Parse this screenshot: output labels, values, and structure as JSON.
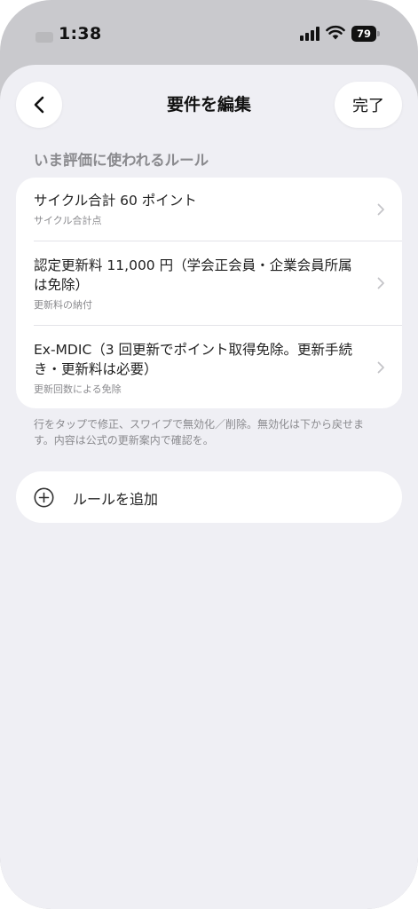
{
  "status_bar": {
    "time": "1:38",
    "battery_level": "79",
    "icons": [
      "signal-icon",
      "wifi-icon",
      "battery-icon"
    ]
  },
  "nav": {
    "back_icon": "chevron-left-icon",
    "title": "要件を編集",
    "done_label": "完了"
  },
  "section": {
    "header": "いま評価に使われるルール"
  },
  "rules": [
    {
      "title": "サイクル合計 60 ポイント",
      "subtitle": "サイクル合計点"
    },
    {
      "title": "認定更新料 11,000 円（学会正会員・企業会員所属は免除）",
      "subtitle": "更新料の納付"
    },
    {
      "title": "Ex-MDIC（3 回更新でポイント取得免除。更新手続き・更新料は必要）",
      "subtitle": "更新回数による免除"
    }
  ],
  "footnote": "行をタップで修正、スワイプで無効化／削除。無効化は下から戻せます。内容は公式の更新案内で確認を。",
  "add_rule": {
    "icon": "plus-circle-icon",
    "label": "ルールを追加"
  },
  "colors": {
    "background": "#efeff4",
    "card": "#ffffff",
    "secondary_text": "#8a8a8e"
  }
}
